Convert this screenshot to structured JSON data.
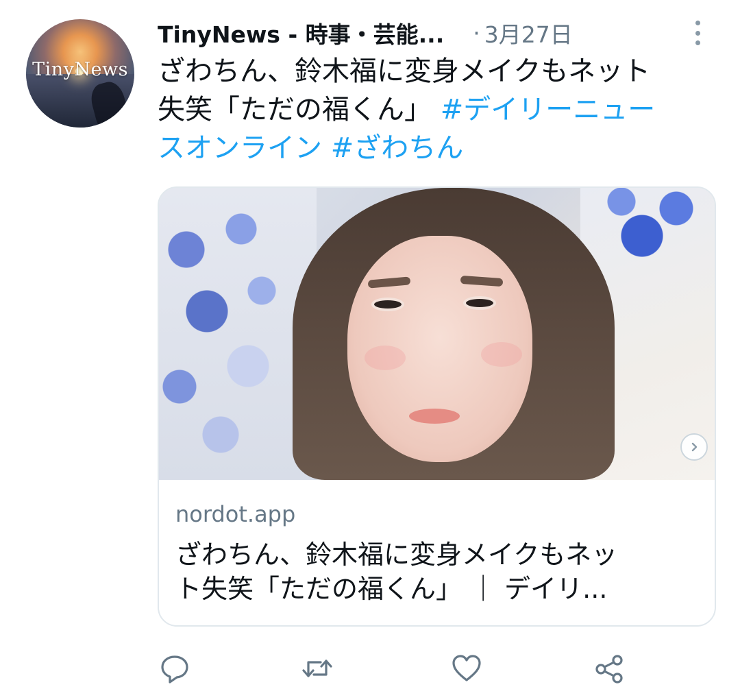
{
  "tweet": {
    "avatar_text": "TinyNews",
    "display_name": "TinyNews - 時事・芸能...",
    "separator": "·",
    "date": "3月27日",
    "text_line1": "ざわちん、鈴木福に変身メイクもネット",
    "text_line2_plain": "失笑「ただの福くん」 ",
    "hashtag1_part1": "#デイリーニュー",
    "hashtag1_part2": "スオンライン",
    "hashtag2": "#ざわちん",
    "hashtag_color": "#1da1f2"
  },
  "card": {
    "domain": "nordot.app",
    "title_line1": "ざわちん、鈴木福に変身メイクもネッ",
    "title_line2": "ト失笑「ただの福くん」 ｜ デイリ..."
  },
  "actions": {
    "icons": [
      "reply-icon",
      "retweet-icon",
      "like-icon",
      "share-icon"
    ]
  }
}
